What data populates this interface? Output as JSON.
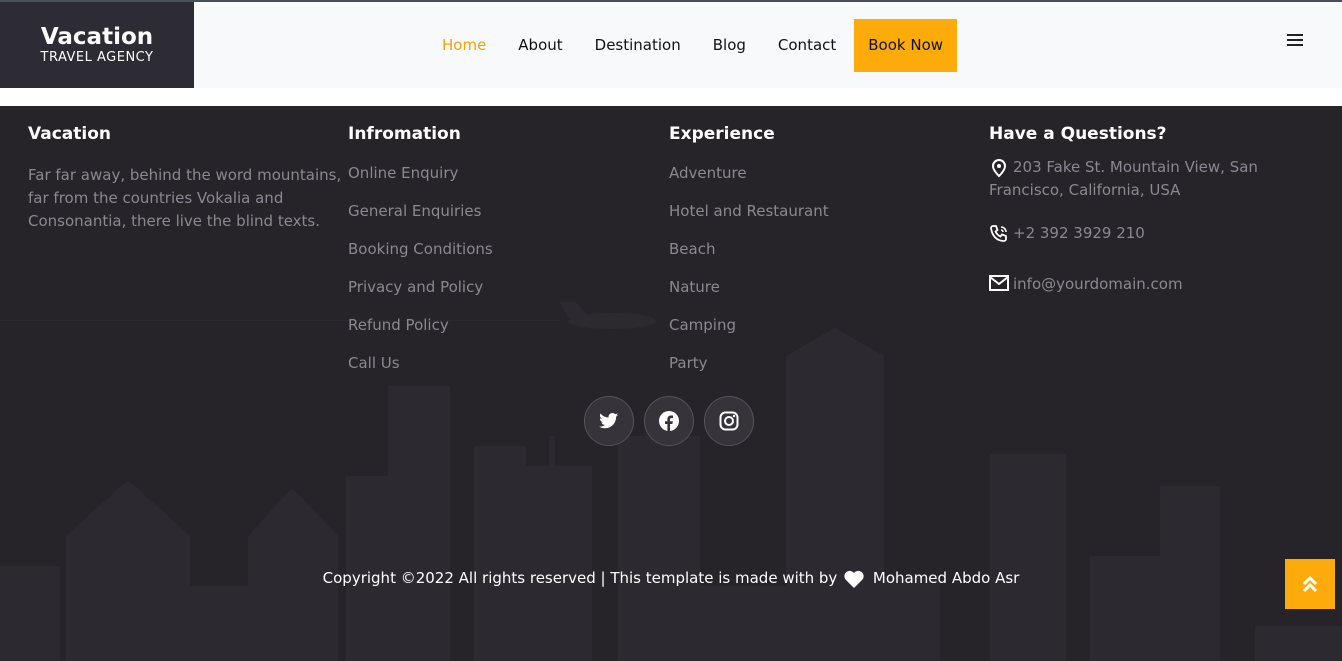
{
  "brand": {
    "name": "Vacation",
    "tagline": "TRAVEL AGENCY"
  },
  "nav": {
    "links": [
      "Home",
      "About",
      "Destination",
      "Blog",
      "Contact"
    ],
    "active": "Home",
    "cta": "Book Now"
  },
  "footer": {
    "about": {
      "title": "Vacation",
      "text": "Far far away, behind the word mountains, far from the countries Vokalia and Consonantia, there live the blind texts."
    },
    "information": {
      "title": "Infromation",
      "items": [
        "Online Enquiry",
        "General Enquiries",
        "Booking Conditions",
        "Privacy and Policy",
        "Refund Policy",
        "Call Us"
      ]
    },
    "experience": {
      "title": "Experience",
      "items": [
        "Adventure",
        "Hotel and Restaurant",
        "Beach",
        "Nature",
        "Camping",
        "Party"
      ]
    },
    "contact": {
      "title": "Have a Questions?",
      "address": "203 Fake St. Mountain View, San Francisco, California, USA",
      "phone": "+2 392 3929 210",
      "email": "info@yourdomain.com"
    },
    "social": [
      "twitter-icon",
      "facebook-icon",
      "instagram-icon"
    ],
    "copyright_pre": "Copyright ©2022 All rights reserved | This template is made with by",
    "copyright_author": "Mohamed Abdo Asr"
  },
  "colors": {
    "accent": "#fcab0b",
    "footer_bg": "#262429",
    "logo_bg": "#2d2b33"
  }
}
